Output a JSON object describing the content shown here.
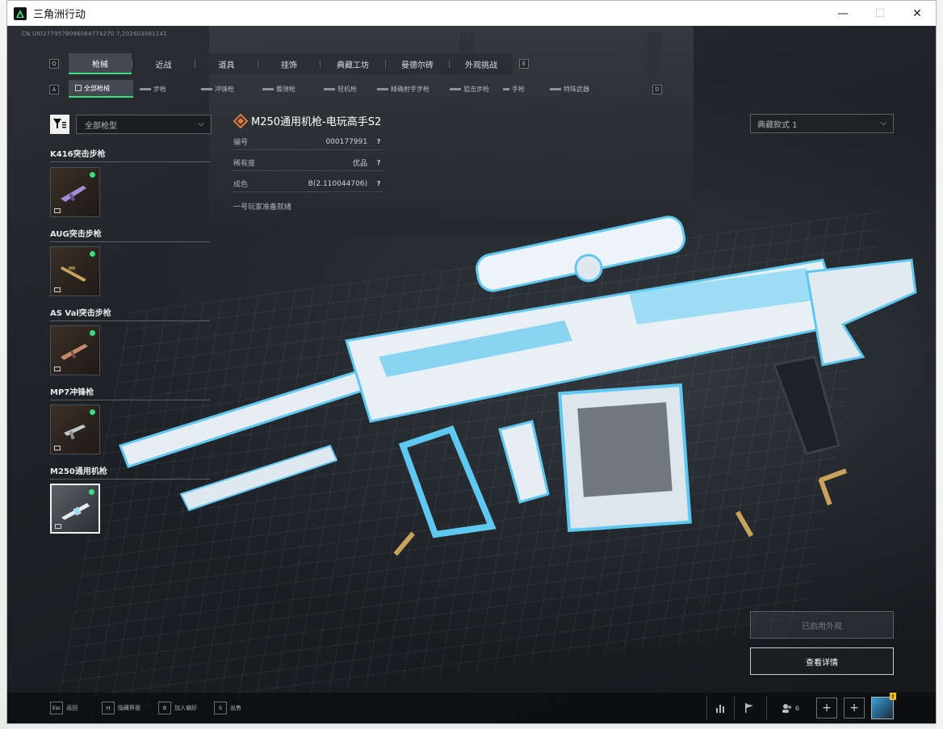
{
  "window": {
    "title": "三角洲行动",
    "minimize_glyph": "—",
    "maximize_glyph": "☐",
    "close_glyph": "✕"
  },
  "uid": "CN UID2779578096064774270 7,202603081141",
  "top_tabs": {
    "left_key": "Q",
    "right_key": "E",
    "items": [
      "枪械",
      "近战",
      "道具",
      "挂饰",
      "典藏工坊",
      "曼德尔砖",
      "外观挑战"
    ]
  },
  "sub_tabs": {
    "left_key": "A",
    "right_key": "D",
    "items": [
      "全部枪械",
      "步枪",
      "冲锋枪",
      "霰弹枪",
      "轻机枪",
      "精确射手步枪",
      "狙击步枪",
      "手枪",
      "特殊武器"
    ]
  },
  "filter": {
    "dropdown_value": "全部枪型",
    "chevron": "⌵"
  },
  "weapons": [
    {
      "name": "K416突击步枪",
      "selected": false
    },
    {
      "name": "AUG突击步枪",
      "selected": false
    },
    {
      "name": "AS Val突击步枪",
      "selected": false
    },
    {
      "name": "MP7冲锋枪",
      "selected": false
    },
    {
      "name": "M250通用机枪",
      "selected": true
    }
  ],
  "detail": {
    "title": "M250通用机枪-电玩高手S2",
    "rows": [
      {
        "key": "编号",
        "value": "000177991",
        "help": "?"
      },
      {
        "key": "稀有度",
        "value": "优品",
        "help": "?"
      },
      {
        "key": "成色",
        "value": "B(2.110044706)",
        "help": "?"
      }
    ],
    "status": "一号玩家准备就绪"
  },
  "skin_dropdown": {
    "value": "典藏款式 1",
    "chevron": "⌵"
  },
  "actions": {
    "applied": "已启用外观",
    "view_detail": "查看详情"
  },
  "bottom_hints": [
    {
      "key": "Esc",
      "label": "返回"
    },
    {
      "key": "H",
      "label": "隐藏界面"
    },
    {
      "key": "B",
      "label": "加入偏好"
    },
    {
      "key": "S",
      "label": "出售"
    }
  ],
  "bottom_right": {
    "friends_count": "6",
    "plus": "+",
    "avatar_badge": "!"
  },
  "colors": {
    "accent_green": "#3ddc84",
    "gun_blue": "#5fc8f0",
    "gun_white": "#e6eef4"
  }
}
